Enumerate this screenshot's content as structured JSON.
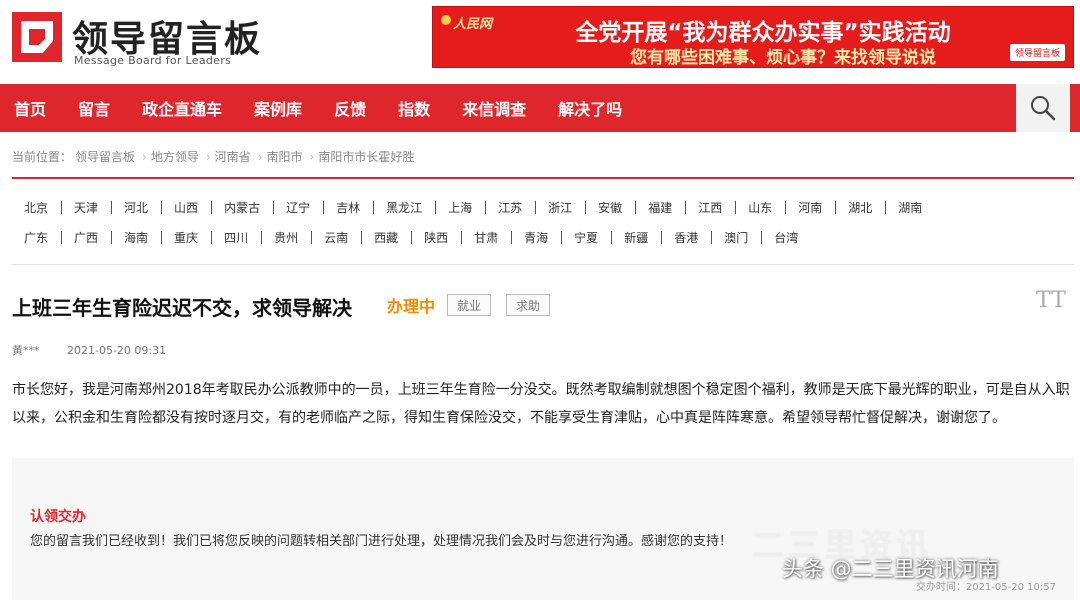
{
  "brand": {
    "title": "领导留言板",
    "subtitle": "Message Board for Leaders"
  },
  "banner": {
    "brand": "人民网",
    "line1": "全党开展“我为群众办实事”实践活动",
    "line2": "您有哪些困难事、烦心事？来找领导说说",
    "tag": "领导留言板"
  },
  "nav": {
    "items": [
      "首页",
      "留言",
      "政企直通车",
      "案例库",
      "反馈",
      "指数",
      "来信调查",
      "解决了吗"
    ],
    "search_icon": "search-icon"
  },
  "breadcrumb": {
    "items": [
      "当前位置：",
      "领导留言板",
      "地方领导",
      "河南省",
      "南阳市",
      "南阳市市长霍好胜"
    ]
  },
  "provinces": {
    "row1": [
      "北京",
      "天津",
      "河北",
      "山西",
      "内蒙古",
      "辽宁",
      "吉林",
      "黑龙江",
      "上海",
      "江苏",
      "浙江",
      "安徽",
      "福建",
      "江西",
      "山东",
      "河南",
      "湖北",
      "湖南"
    ],
    "row2": [
      "广东",
      "广西",
      "海南",
      "重庆",
      "四川",
      "贵州",
      "云南",
      "西藏",
      "陕西",
      "甘肃",
      "青海",
      "宁夏",
      "新疆",
      "香港",
      "澳门",
      "台湾"
    ]
  },
  "message": {
    "title": "上班三年生育险迟迟不交，求领导解决",
    "status": "办理中",
    "tag1": "就业",
    "tag2": "求助",
    "font_toggle": "TT",
    "author": "黄***",
    "date": "2021-05-20 09:31",
    "body": "市长您好，我是河南郑州2018年考取民办公派教师中的一员，上班三年生育险一分没交。既然考取编制就想图个稳定图个福利，教师是天底下最光辉的职业，可是自从入职以来，公积金和生育险都没有按时逐月交，有的老师临产之际，得知生育保险没交，不能享受生育津贴，心中真是阵阵寒意。希望领导帮忙督促解决，谢谢您了。"
  },
  "reply": {
    "title": "认领交办",
    "text": "您的留言我们已经收到！我们已将您反映的问题转相关部门进行处理，处理情况我们会及时与您进行沟通。感谢您的支持！",
    "time": "交办时间：2021-05-20 10:57"
  },
  "overlay": {
    "watermark": "二三里资讯",
    "toutiao": "头条 @二三里资讯河南"
  }
}
